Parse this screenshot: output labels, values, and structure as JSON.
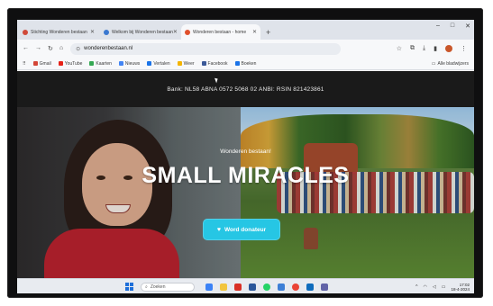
{
  "browser": {
    "tabs": [
      {
        "label": "Stichting Wonderen bestaan",
        "active": false,
        "favicon_color": "#d04a3a"
      },
      {
        "label": "Welkom bij Wonderen bestaan",
        "active": false,
        "favicon_color": "#3a78d0"
      },
      {
        "label": "Wonderen bestaan - home",
        "active": true,
        "favicon_color": "#e0502c"
      }
    ],
    "new_tab_label": "+",
    "window_controls": [
      "–",
      "□",
      "✕"
    ],
    "address": "wonderenbestaan.nl",
    "bookmarks": [
      {
        "label": "Gmail",
        "color": "#d44638"
      },
      {
        "label": "YouTube",
        "color": "#e62117"
      },
      {
        "label": "Kaarten",
        "color": "#34a853"
      },
      {
        "label": "Nieuws",
        "color": "#4285f4"
      },
      {
        "label": "Vertalen",
        "color": "#1a73e8"
      },
      {
        "label": "Weer",
        "color": "#f4b400"
      },
      {
        "label": "Facebook",
        "color": "#3b5998"
      },
      {
        "label": "Boeken",
        "color": "#1a73e8"
      }
    ],
    "bookmarks_all": "Alle bladwijzers"
  },
  "site": {
    "bank_info": "Bank: NL58 ABNA 0572 5068 02 ANBI: RSIN 821423861",
    "hero": {
      "kicker": "Wonderen bestaan!",
      "title": "SMALL MIRACLES",
      "donate_button": "Word donateur"
    }
  },
  "taskbar": {
    "search_placeholder": "Zoeken",
    "icons": [
      {
        "name": "widgets",
        "color": "#3b82f6"
      },
      {
        "name": "file-explorer",
        "color": "#f2c53d"
      },
      {
        "name": "pdf-reader",
        "color": "#d93025"
      },
      {
        "name": "word",
        "color": "#2b579a"
      },
      {
        "name": "whatsapp",
        "color": "#25d366"
      },
      {
        "name": "store",
        "color": "#3d7fd6"
      },
      {
        "name": "chrome",
        "color": "#ea4335"
      },
      {
        "name": "outlook",
        "color": "#0f6cbd"
      },
      {
        "name": "teams",
        "color": "#6264a7"
      }
    ],
    "time": "17:02",
    "date": "18-4-2024"
  },
  "colors": {
    "donate": "#26c6e4",
    "bank_bar": "#1a1a1a"
  }
}
